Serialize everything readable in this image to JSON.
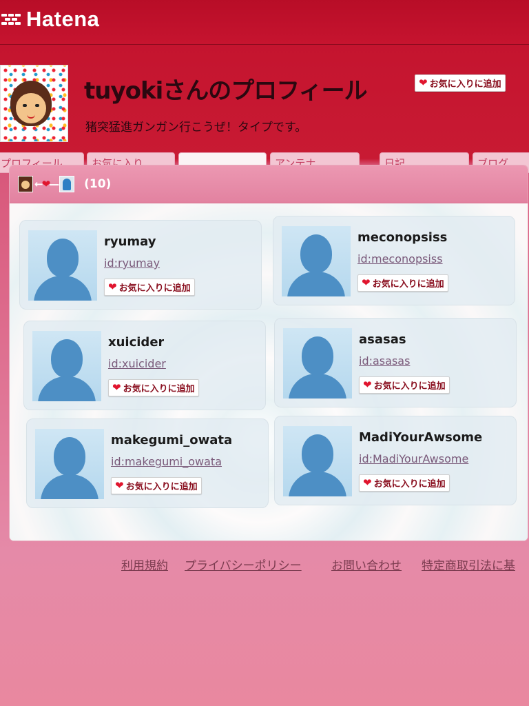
{
  "app": {
    "logo": "Hatena"
  },
  "profile": {
    "title": "tuyokiさんのプロフィール",
    "subtitle": "猪突猛進ガンガン行こうぜ！タイプです。",
    "favorite_label": "お気に入りに追加"
  },
  "tabs": [
    {
      "label": "プロフィール"
    },
    {
      "label": "お気に入り"
    },
    {
      "label": ""
    },
    {
      "label": "アンテナ"
    },
    {
      "label": "日記"
    },
    {
      "label": "ブログ"
    }
  ],
  "panel": {
    "count": "(10)"
  },
  "users": [
    {
      "name": "ryumay",
      "id": "id:ryumay",
      "favorite": "お気に入りに追加"
    },
    {
      "name": "meconopsiss",
      "id": "id:meconopsiss",
      "favorite": "お気に入りに追加"
    },
    {
      "name": "xuicider",
      "id": "id:xuicider",
      "favorite": "お気に入りに追加"
    },
    {
      "name": "asasas",
      "id": "id:asasas",
      "favorite": "お気に入りに追加"
    },
    {
      "name": "makegumi_owata",
      "id": "id:makegumi_owata",
      "favorite": "お気に入りに追加"
    },
    {
      "name": "MadiYourAwsome",
      "id": "id:MadiYourAwsome",
      "favorite": "お気に入りに追加"
    }
  ],
  "footer": {
    "links": [
      "利用規約",
      "プライバシーポリシー",
      "お問い合わせ",
      "特定商取引法に基"
    ]
  },
  "colors": {
    "brand": "#c3122d",
    "panel_header": "#e282a0",
    "heart": "#e0152e"
  }
}
